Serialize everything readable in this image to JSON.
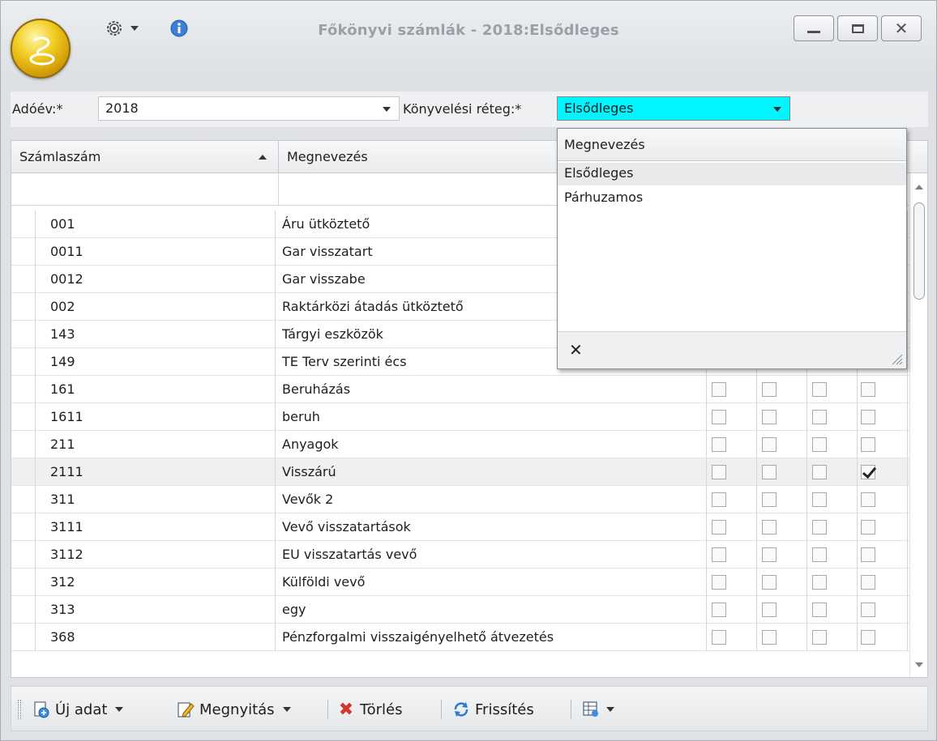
{
  "window": {
    "title": "Főkönyvi számlák - 2018:Elsődleges"
  },
  "filter": {
    "year_label": "Adóév:*",
    "year_value": "2018",
    "layer_label": "Könyvelési réteg:*",
    "layer_value": "Elsődleges"
  },
  "grid": {
    "col_account": "Számlaszám",
    "col_name": "Megnevezés",
    "rows": [
      {
        "acct": "001",
        "name": "Áru ütköztető"
      },
      {
        "acct": "0011",
        "name": "Gar visszatart"
      },
      {
        "acct": "0012",
        "name": "Gar visszabe"
      },
      {
        "acct": "002",
        "name": "Raktárközi átadás ütköztető"
      },
      {
        "acct": "143",
        "name": "Tárgyi eszközök"
      },
      {
        "acct": "149",
        "name": "TE Terv szerinti écs"
      },
      {
        "acct": "161",
        "name": "Beruházás"
      },
      {
        "acct": "1611",
        "name": "beruh"
      },
      {
        "acct": "211",
        "name": "Anyagok"
      },
      {
        "acct": "2111",
        "name": "Visszárú"
      },
      {
        "acct": "311",
        "name": "Vevők 2"
      },
      {
        "acct": "3111",
        "name": "Vevő visszatartások"
      },
      {
        "acct": "3112",
        "name": "EU visszatartás vevő"
      },
      {
        "acct": "312",
        "name": "Külföldi vevő"
      },
      {
        "acct": "313",
        "name": "egy"
      },
      {
        "acct": "368",
        "name": "Pénzforgalmi visszaigényelhető átvezetés"
      }
    ]
  },
  "dropdown": {
    "header": "Megnevezés",
    "options": [
      "Elsődleges",
      "Párhuzamos"
    ]
  },
  "toolbar": {
    "new": "Új adat",
    "open": "Megnyitás",
    "delete": "Törlés",
    "refresh": "Frissítés"
  },
  "colors": {
    "active_combo": "#00f5ff",
    "delete_icon": "#d8342c",
    "app_orb": "#f1cc21"
  },
  "icons": {
    "app": "app-orb-icon",
    "settings": "gear-icon",
    "info": "info-icon",
    "new": "add-document-icon",
    "open": "edit-pencil-icon",
    "delete": "delete-x-icon",
    "refresh": "refresh-icon",
    "layout": "grid-layout-icon"
  }
}
